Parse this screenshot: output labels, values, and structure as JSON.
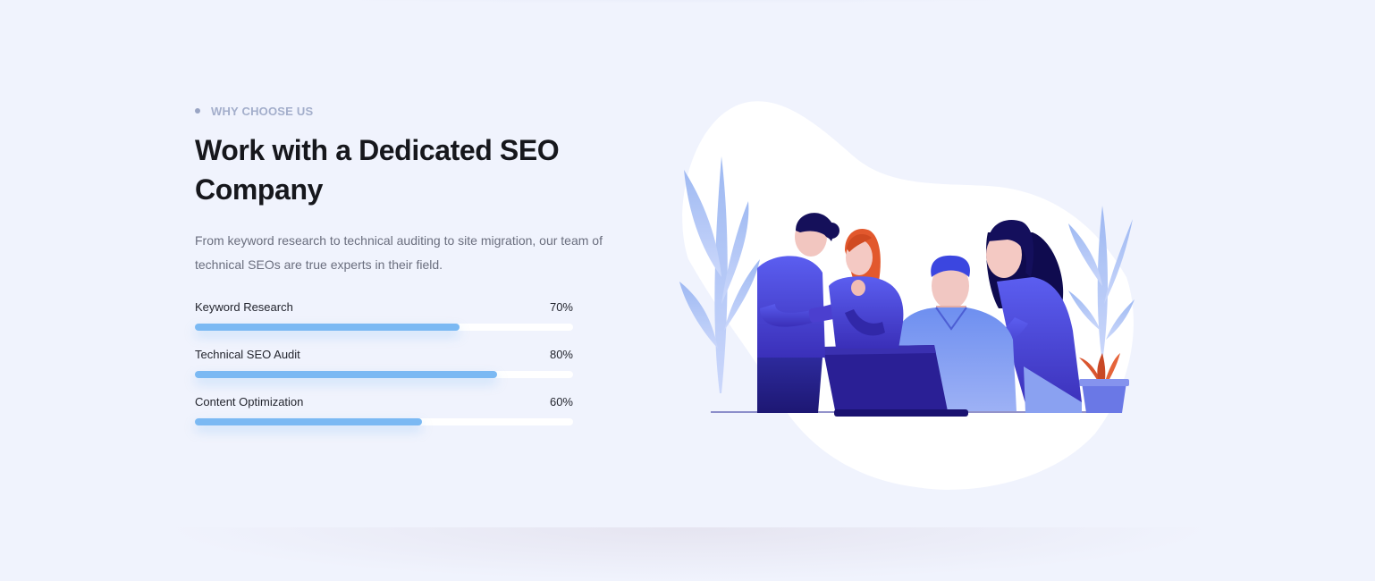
{
  "section": {
    "eyebrow": "WHY CHOOSE US",
    "title": "Work with a Dedicated SEO Company",
    "description": "From keyword research to technical auditing to site migration, our team of technical SEOs are true experts in their field."
  },
  "skills": [
    {
      "label": "Keyword Research",
      "percent_label": "70%",
      "value": 70
    },
    {
      "label": "Technical SEO Audit",
      "percent_label": "80%",
      "value": 80
    },
    {
      "label": "Content Optimization",
      "percent_label": "60%",
      "value": 60
    }
  ],
  "colors": {
    "background": "#f0f3fd",
    "accent_bar": "#7bb9f3",
    "title": "#16171c",
    "illustration_primary": "#5b5ef0"
  },
  "illustration": {
    "icon": "team-working-at-laptop-illustration"
  }
}
